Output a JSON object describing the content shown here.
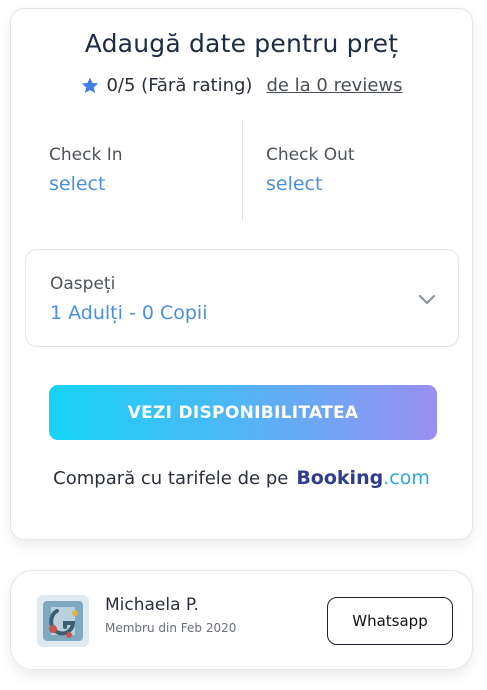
{
  "booking": {
    "title": "Adaugă date pentru preț",
    "rating": "0/5 (Fără rating)",
    "reviews_link": "de la 0 reviews",
    "check_in": {
      "label": "Check In",
      "value": "select"
    },
    "check_out": {
      "label": "Check Out",
      "value": "select"
    },
    "guests": {
      "label": "Oaspeți",
      "value": "1 Adulți - 0 Copii"
    },
    "cta_label": "VEZI DISPONIBILITATEA",
    "compare_text": "Compară cu tarifele de pe",
    "compare_brand": {
      "part1": "Booking",
      "part2": ".com"
    }
  },
  "host": {
    "name": "Michaela P.",
    "member_since": "Membru din Feb 2020",
    "whatsapp_label": "Whatsapp"
  },
  "colors": {
    "accent_blue": "#4a8fe0",
    "star": "#3e7fe8",
    "cta_gradient": [
      "#16d3f6",
      "#9a8ef2"
    ],
    "booking_dark": "#2d3e8f",
    "booking_light": "#2aa7de"
  },
  "icons": {
    "star": "star-icon",
    "chevron": "chevron-down-icon",
    "avatar": "avatar-image"
  }
}
